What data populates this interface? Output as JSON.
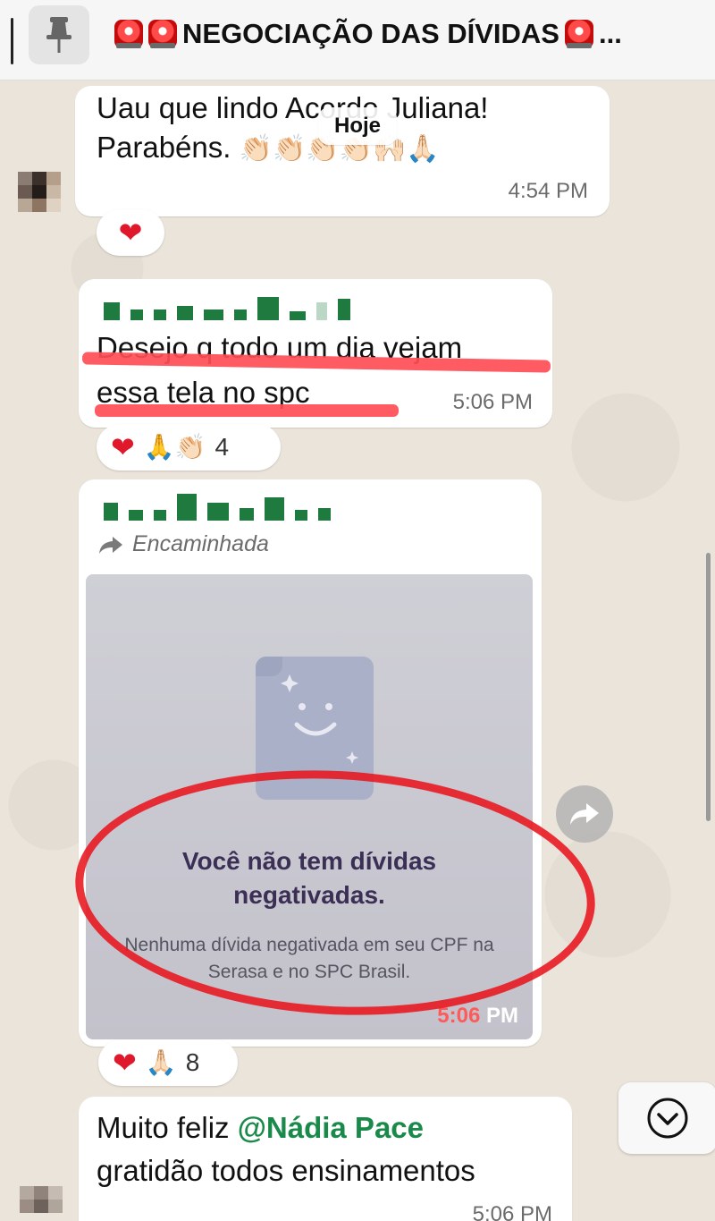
{
  "header": {
    "title": "NEGOCIAÇÃO DAS DÍVIDAS",
    "ellipsis": "..."
  },
  "date_chip": "Hoje",
  "messages": [
    {
      "text_line1": "Uau que lindo Acordo Juliana!",
      "text_line2": "Parabéns.",
      "emojis": "👏🏻👏🏻👏🏻👏🏻🙌🏻🙏🏻",
      "time": "4:54 PM",
      "reactions": {
        "heart": "❤",
        "count": ""
      }
    },
    {
      "text_line1": "Desejo q todo um dia vejam",
      "text_line2": "essa tela no spc",
      "time": "5:06 PM",
      "reactions": {
        "heart": "❤",
        "emojis": "🙏👏🏻",
        "count": "4"
      }
    },
    {
      "forwarded_label": "Encaminhada",
      "image": {
        "title": "Você não tem dívidas negativadas.",
        "subtitle": "Nenhuma dívida negativada em seu CPF na Serasa e no SPC Brasil.",
        "time": "5:06 PM",
        "time_prefix": "5:06",
        "time_suffix": " PM"
      },
      "reactions": {
        "heart": "❤",
        "emojis": "🙏🏻",
        "count": "8"
      }
    },
    {
      "text_prefix": "Muito feliz ",
      "mention": "@Nádia Pace",
      "text_line2": "gratidão todos ensinamentos",
      "time": "5:06 PM"
    }
  ],
  "colors": {
    "name_green": "#1e7a3e",
    "mention_green": "#1a8a4a",
    "highlight_red": "#ff4d56",
    "circle_red": "#e8161e"
  },
  "icons": [
    "pin-icon",
    "siren-icon",
    "forward-arrow-icon",
    "share-icon",
    "chevron-down-icon"
  ]
}
